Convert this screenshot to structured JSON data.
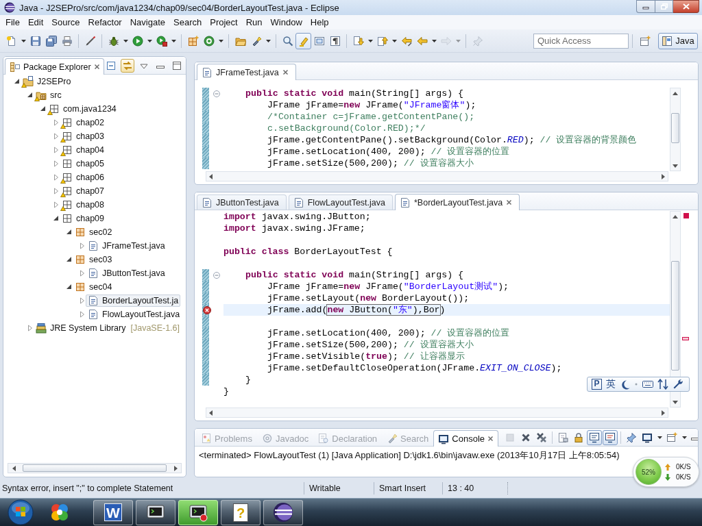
{
  "window": {
    "title": "Java - J2SEPro/src/com/java1234/chap09/sec04/BorderLayoutTest.java - Eclipse"
  },
  "menu": [
    "File",
    "Edit",
    "Source",
    "Refactor",
    "Navigate",
    "Search",
    "Project",
    "Run",
    "Window",
    "Help"
  ],
  "toolbar": {
    "groups": [
      [
        {
          "kind": "new",
          "menu": true
        },
        {
          "kind": "save"
        },
        {
          "kind": "saveall"
        },
        {
          "kind": "print"
        }
      ],
      [
        {
          "kind": "pen"
        }
      ],
      [
        {
          "kind": "debug",
          "menu": true
        },
        {
          "kind": "run",
          "menu": true
        },
        {
          "kind": "tools",
          "menu": true
        }
      ],
      [
        {
          "kind": "package"
        },
        {
          "kind": "class",
          "menu": true
        }
      ],
      [
        {
          "kind": "type"
        },
        {
          "kind": "search",
          "menu": true
        }
      ],
      [
        {
          "kind": "magnifier"
        },
        {
          "kind": "highlight",
          "pressed": true
        },
        {
          "kind": "block"
        },
        {
          "kind": "whitespace"
        }
      ],
      [
        {
          "kind": "next",
          "menu": true
        },
        {
          "kind": "previous",
          "menu": true
        },
        {
          "kind": "lastedit"
        },
        {
          "kind": "back",
          "menu": true
        },
        {
          "kind": "forward",
          "disabled": true,
          "menu": true
        }
      ],
      [
        {
          "kind": "pin",
          "disabled": true
        }
      ]
    ],
    "quick_access": {
      "placeholder": "Quick Access"
    },
    "perspectives": [
      {
        "label": "Java",
        "selected": true
      }
    ]
  },
  "package_explorer": {
    "title": "Package Explorer",
    "link_with_editor": true,
    "tree": [
      {
        "label": "J2SEPro",
        "kind": "project",
        "expanded": true,
        "warning": true,
        "selected": false,
        "children": [
          {
            "label": "src",
            "kind": "source-folder",
            "expanded": true,
            "warning": true,
            "selected": false,
            "children": [
              {
                "label": "com.java1234",
                "kind": "package",
                "expanded": true,
                "warning": true,
                "selected": false,
                "children": [
                  {
                    "label": "chap02",
                    "kind": "package",
                    "expanded": false,
                    "warning": true,
                    "selected": false
                  },
                  {
                    "label": "chap03",
                    "kind": "package",
                    "expanded": false,
                    "warning": true,
                    "selected": false
                  },
                  {
                    "label": "chap04",
                    "kind": "package",
                    "expanded": false,
                    "warning": true,
                    "selected": false
                  },
                  {
                    "label": "chap05",
                    "kind": "package",
                    "expanded": false,
                    "selected": false
                  },
                  {
                    "label": "chap06",
                    "kind": "package",
                    "expanded": false,
                    "warning": true,
                    "selected": false
                  },
                  {
                    "label": "chap07",
                    "kind": "package",
                    "expanded": false,
                    "warning": true,
                    "selected": false
                  },
                  {
                    "label": "chap08",
                    "kind": "package",
                    "expanded": false,
                    "warning": true,
                    "selected": false
                  },
                  {
                    "label": "chap09",
                    "kind": "package",
                    "expanded": true,
                    "selected": false,
                    "children": [
                      {
                        "label": "sec02",
                        "kind": "subpackage",
                        "expanded": true,
                        "selected": false,
                        "children": [
                          {
                            "label": "JFrameTest.java",
                            "kind": "java-file",
                            "expanded": false,
                            "selected": false
                          }
                        ]
                      },
                      {
                        "label": "sec03",
                        "kind": "subpackage",
                        "expanded": true,
                        "selected": false,
                        "children": [
                          {
                            "label": "JButtonTest.java",
                            "kind": "java-file",
                            "expanded": false,
                            "selected": false
                          }
                        ]
                      },
                      {
                        "label": "sec04",
                        "kind": "subpackage",
                        "expanded": true,
                        "selected": false,
                        "children": [
                          {
                            "label": "BorderLayoutTest.ja",
                            "kind": "java-file",
                            "expanded": false,
                            "selected": true
                          },
                          {
                            "label": "FlowLayoutTest.java",
                            "kind": "java-file",
                            "expanded": false,
                            "selected": false
                          }
                        ]
                      }
                    ]
                  }
                ]
              }
            ]
          },
          {
            "label": "JRE System Library",
            "decoration": "[JavaSE-1.6]",
            "kind": "library",
            "expanded": false,
            "selected": false
          }
        ]
      }
    ]
  },
  "editors": [
    {
      "tabs": [
        {
          "label": "JFrameTest.java",
          "selected": true
        }
      ],
      "lines": [
        {
          "kind": "fold",
          "changed": true,
          "segments": [
            {
              "kind": "keyword",
              "text": "public static void"
            },
            {
              "kind": "plain",
              "text": " main(String[] args) {"
            }
          ],
          "children": [
            {
              "kind": "code",
              "changed": true,
              "segments": [
                {
                  "kind": "plain",
                  "text": "JFrame jFrame="
                },
                {
                  "kind": "keyword",
                  "text": "new"
                },
                {
                  "kind": "plain",
                  "text": " JFrame("
                },
                {
                  "kind": "string",
                  "text": "\"JFrame窗体\""
                },
                {
                  "kind": "plain",
                  "text": ");"
                }
              ]
            },
            {
              "kind": "code",
              "changed": true,
              "segments": [
                {
                  "kind": "comment",
                  "text": "/*Container c=jFrame.getContentPane();"
                }
              ]
            },
            {
              "kind": "code",
              "changed": true,
              "segments": [
                {
                  "kind": "comment",
                  "text": "c.setBackground(Color.RED);*/"
                }
              ]
            },
            {
              "kind": "code",
              "changed": true,
              "segments": [
                {
                  "kind": "plain",
                  "text": "jFrame.getContentPane().setBackground(Color."
                },
                {
                  "kind": "constant",
                  "text": "RED"
                },
                {
                  "kind": "plain",
                  "text": "); "
                },
                {
                  "kind": "comment",
                  "text": "// 设置容器的背景颜色"
                }
              ]
            },
            {
              "kind": "code",
              "changed": true,
              "segments": [
                {
                  "kind": "plain",
                  "text": "jFrame.setLocation(400, 200); "
                },
                {
                  "kind": "comment",
                  "text": "// 设置容器的位置"
                }
              ]
            },
            {
              "kind": "code",
              "changed": true,
              "segments": [
                {
                  "kind": "plain",
                  "text": "jFrame.setSize(500,200); "
                },
                {
                  "kind": "comment",
                  "text": "// 设置容器大小"
                }
              ]
            }
          ]
        }
      ]
    },
    {
      "tabs": [
        {
          "label": "JButtonTest.java",
          "selected": false
        },
        {
          "label": "FlowLayoutTest.java",
          "selected": false
        },
        {
          "label": "*BorderLayoutTest.java",
          "selected": true
        }
      ],
      "lines": [
        {
          "kind": "code",
          "segments": [
            {
              "kind": "keyword",
              "text": "import"
            },
            {
              "kind": "plain",
              "text": " javax.swing.JButton;"
            }
          ]
        },
        {
          "kind": "code",
          "segments": [
            {
              "kind": "keyword",
              "text": "import"
            },
            {
              "kind": "plain",
              "text": " javax.swing.JFrame;"
            }
          ]
        },
        {
          "kind": "blank"
        },
        {
          "kind": "code",
          "segments": [
            {
              "kind": "keyword",
              "text": "public class"
            },
            {
              "kind": "plain",
              "text": " BorderLayoutTest {"
            }
          ],
          "children": [
            {
              "kind": "blank"
            },
            {
              "kind": "fold",
              "changed": true,
              "segments": [
                {
                  "kind": "keyword",
                  "text": "public static void"
                },
                {
                  "kind": "plain",
                  "text": " main(String[] args) {"
                }
              ],
              "children": [
                {
                  "kind": "code",
                  "changed": true,
                  "segments": [
                    {
                      "kind": "plain",
                      "text": "JFrame jFrame="
                    },
                    {
                      "kind": "keyword",
                      "text": "new"
                    },
                    {
                      "kind": "plain",
                      "text": " JFrame("
                    },
                    {
                      "kind": "string",
                      "text": "\"BorderLayout测试\""
                    },
                    {
                      "kind": "plain",
                      "text": ");"
                    }
                  ]
                },
                {
                  "kind": "code",
                  "changed": true,
                  "segments": [
                    {
                      "kind": "plain",
                      "text": "jFrame.setLayout("
                    },
                    {
                      "kind": "keyword",
                      "text": "new"
                    },
                    {
                      "kind": "plain",
                      "text": " BorderLayout());"
                    }
                  ]
                },
                {
                  "kind": "code",
                  "current": true,
                  "error": true,
                  "changed": true,
                  "segments": [
                    {
                      "kind": "plain",
                      "text": "jFrame.add("
                    },
                    {
                      "kind": "linked",
                      "segments": [
                        {
                          "kind": "keyword",
                          "text": "new"
                        },
                        {
                          "kind": "plain",
                          "text": " JButton("
                        },
                        {
                          "kind": "string",
                          "text": "\"东\""
                        },
                        {
                          "kind": "plain",
                          "text": "),Bor"
                        }
                      ]
                    },
                    {
                      "kind": "plain",
                      "text": ")"
                    }
                  ]
                },
                {
                  "kind": "blank",
                  "changed": true
                },
                {
                  "kind": "code",
                  "changed": true,
                  "segments": [
                    {
                      "kind": "plain",
                      "text": "jFrame.setLocation(400, 200); "
                    },
                    {
                      "kind": "comment",
                      "text": "// 设置容器的位置"
                    }
                  ]
                },
                {
                  "kind": "code",
                  "changed": true,
                  "segments": [
                    {
                      "kind": "plain",
                      "text": "jFrame.setSize(500,200); "
                    },
                    {
                      "kind": "comment",
                      "text": "// 设置容器大小"
                    }
                  ]
                },
                {
                  "kind": "code",
                  "changed": true,
                  "segments": [
                    {
                      "kind": "plain",
                      "text": "jFrame.setVisible("
                    },
                    {
                      "kind": "keyword",
                      "text": "true"
                    },
                    {
                      "kind": "plain",
                      "text": "); "
                    },
                    {
                      "kind": "comment",
                      "text": "// 让容器显示"
                    }
                  ]
                },
                {
                  "kind": "code",
                  "changed": true,
                  "segments": [
                    {
                      "kind": "plain",
                      "text": "jFrame.setDefaultCloseOperation(JFrame."
                    },
                    {
                      "kind": "constant",
                      "text": "EXIT_ON_CLOSE"
                    },
                    {
                      "kind": "plain",
                      "text": ");"
                    }
                  ]
                }
              ]
            },
            {
              "kind": "code",
              "changed": true,
              "segments": [
                {
                  "kind": "plain",
                  "text": "}"
                }
              ]
            }
          ]
        },
        {
          "kind": "code",
          "segments": [
            {
              "kind": "plain",
              "text": "}"
            }
          ]
        }
      ]
    }
  ],
  "ime_toolbar": {
    "logo": "P",
    "mode": "英"
  },
  "bottom_panel": {
    "tabs": [
      {
        "label": "Problems",
        "selected": false
      },
      {
        "label": "Javadoc",
        "selected": false
      },
      {
        "label": "Declaration",
        "selected": false
      },
      {
        "label": "Search",
        "selected": false
      },
      {
        "label": "Console",
        "selected": true
      }
    ],
    "toolbar": {
      "groups": [
        [
          {
            "kind": "terminate",
            "disabled": true
          },
          {
            "kind": "remove"
          },
          {
            "kind": "removeall"
          }
        ],
        [
          {
            "kind": "clear"
          },
          {
            "kind": "lock"
          },
          {
            "kind": "stdout",
            "pressed": true
          },
          {
            "kind": "stderr",
            "pressed": true
          }
        ],
        [
          {
            "kind": "pin"
          },
          {
            "kind": "display",
            "menu": true
          },
          {
            "kind": "open",
            "menu": true
          }
        ]
      ]
    },
    "console_text": "<terminated> FlowLayoutTest (1) [Java Application] D:\\jdk1.6\\bin\\javaw.exe (2013年10月17日 上午8:05:54)"
  },
  "net_monitor": {
    "usage": "52%",
    "upload": "0K/S",
    "download": "0K/S"
  },
  "status_bar": {
    "message": "Syntax error, insert \";\" to complete Statement",
    "writable": "Writable",
    "insert_mode": "Smart Insert",
    "position": "13 : 40"
  },
  "taskbar": {
    "items": [
      {
        "kind": "start",
        "selected": false
      },
      {
        "kind": "app",
        "selected": false
      },
      {
        "kind": "writer",
        "logo": "W",
        "running": true,
        "selected": false
      },
      {
        "kind": "terminal",
        "running": true,
        "selected": false
      },
      {
        "kind": "terminal-run",
        "running": true,
        "selected": true
      },
      {
        "kind": "help",
        "logo": "?",
        "running": true,
        "selected": false
      },
      {
        "kind": "eclipse",
        "running": true,
        "selected": false
      }
    ]
  }
}
